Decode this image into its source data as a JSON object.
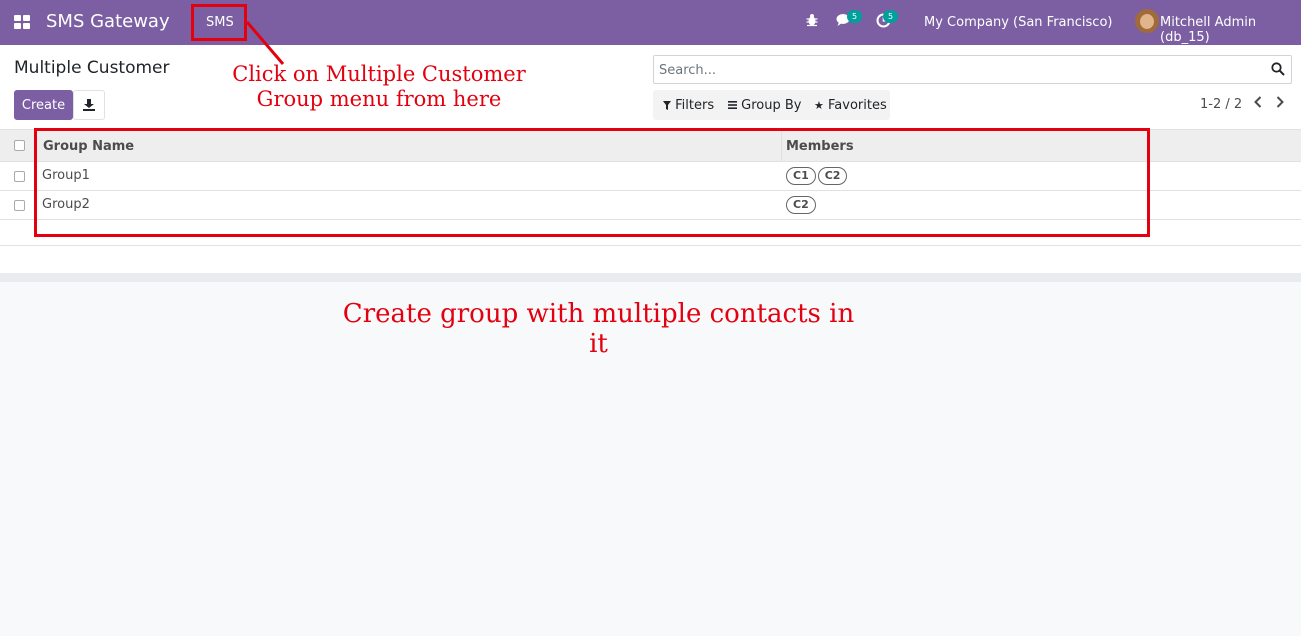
{
  "navbar": {
    "brand": "SMS Gateway",
    "menu_sms": "SMS",
    "messages_badge": "5",
    "activities_badge": "5",
    "company": "My Company (San Francisco)",
    "user": "Mitchell Admin (db_15)"
  },
  "control": {
    "title": "Multiple Customer",
    "create_label": "Create",
    "search_placeholder": "Search...",
    "filters_label": "Filters",
    "groupby_label": "Group By",
    "favorites_label": "Favorites",
    "pager": "1-2 / 2"
  },
  "list": {
    "columns": [
      "Group Name",
      "Members"
    ],
    "rows": [
      {
        "name": "Group1",
        "members": [
          "C1",
          "C2"
        ]
      },
      {
        "name": "Group2",
        "members": [
          "C2"
        ]
      }
    ]
  },
  "annotations": {
    "menu_hint_line1": "Click on Multiple Customer",
    "menu_hint_line2": "Group menu from here",
    "group_hint": "Create group with multiple contacts in it"
  },
  "colors": {
    "brand": "#7c5ea3",
    "annotation": "#e3000f",
    "badge": "#00a09d"
  }
}
